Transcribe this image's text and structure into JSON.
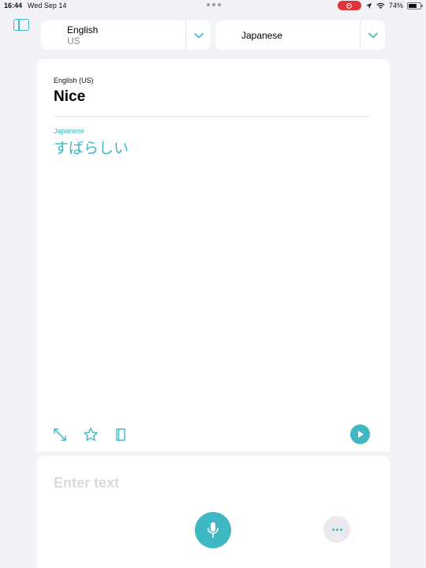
{
  "status_bar": {
    "time": "16:44",
    "date": "Wed Sep 14",
    "battery": "74%",
    "battery_level": 0.74
  },
  "source_language": {
    "name": "English",
    "region": "US"
  },
  "target_language": {
    "name": "Japanese"
  },
  "translation": {
    "source_label": "English (US)",
    "source_text": "Nice",
    "target_label": "Japanese",
    "target_text": "すばらしい"
  },
  "input": {
    "placeholder": "Enter text"
  },
  "colors": {
    "accent": "#3fb8c4",
    "background": "#f2f2f7",
    "record": "#e0343a"
  },
  "icons": {
    "sidebar": "sidebar-icon",
    "chevron": "chevron-down-icon",
    "expand": "expand-icon",
    "favorite": "star-icon",
    "dictionary": "book-icon",
    "play": "play-icon",
    "microphone": "microphone-icon",
    "more": "ellipsis-icon"
  }
}
